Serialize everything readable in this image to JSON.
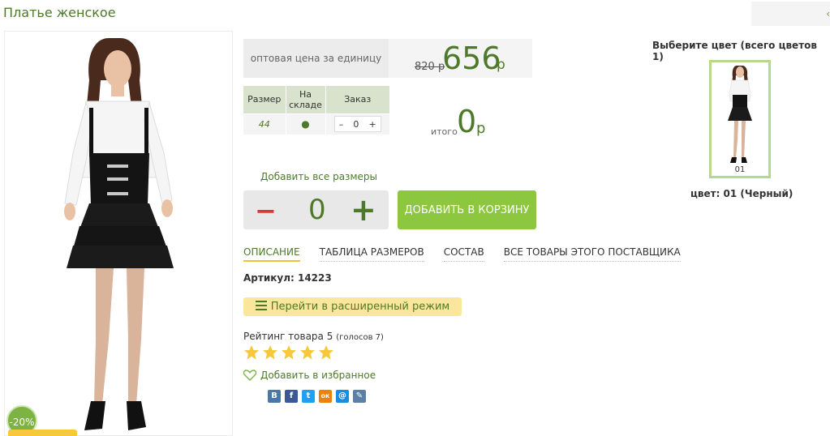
{
  "page": {
    "title": "Платье женское",
    "top_arrow": "‹"
  },
  "product": {
    "discount": "-20%"
  },
  "price": {
    "label": "оптовая цена за единицу",
    "old": "820 р",
    "new": "656",
    "currency": "р"
  },
  "size_table": {
    "headers": [
      "Размер",
      "На складе",
      "Заказ"
    ],
    "rows": [
      {
        "size": "44",
        "stock": "●",
        "minus": "–",
        "qty": "0",
        "plus": "+"
      }
    ]
  },
  "total": {
    "label": "итого",
    "value": "0",
    "currency": "р"
  },
  "add_all_sizes": "Добавить все размеры",
  "quantity": {
    "minus": "−",
    "value": "0",
    "plus": "+"
  },
  "cart_button": "ДОБАВИТЬ В КОРЗИНУ",
  "tabs": [
    {
      "label": "ОПИСАНИЕ",
      "active": true
    },
    {
      "label": "ТАБЛИЦА РАЗМЕРОВ",
      "active": false
    },
    {
      "label": "СОСТАВ",
      "active": false
    },
    {
      "label": "ВСЕ ТОВАРЫ ЭТОГО ПОСТАВЩИКА",
      "active": false
    }
  ],
  "article": "Артикул: 14223",
  "extended_mode": "Перейти в расширенный режим",
  "rating": {
    "text": "Рейтинг товара 5",
    "votes": "(голосов 7)",
    "stars": 5
  },
  "favorite": "Добавить в избранное",
  "social": [
    {
      "name": "vk-icon",
      "glyph": "В",
      "color": "#4a76a8"
    },
    {
      "name": "facebook-icon",
      "glyph": "f",
      "color": "#3b5998"
    },
    {
      "name": "twitter-icon",
      "glyph": "t",
      "color": "#1da1f2"
    },
    {
      "name": "odnoklassniki-icon",
      "glyph": "ок",
      "color": "#ee8208"
    },
    {
      "name": "mailru-icon",
      "glyph": "@",
      "color": "#168de2"
    },
    {
      "name": "livejournal-icon",
      "glyph": "✎",
      "color": "#5b7fa6"
    }
  ],
  "colors": {
    "title": "Выберите цвет (всего цветов 1)",
    "items": [
      {
        "code": "01"
      }
    ],
    "caption": "цвет: 01 (Черный)"
  },
  "theme": {
    "accent_green": "#4d7a2a",
    "button_green": "#8dc63f",
    "minus_red": "#d43a3a",
    "star_yellow": "#f6c83a",
    "yellow_button": "#fbe79c"
  }
}
